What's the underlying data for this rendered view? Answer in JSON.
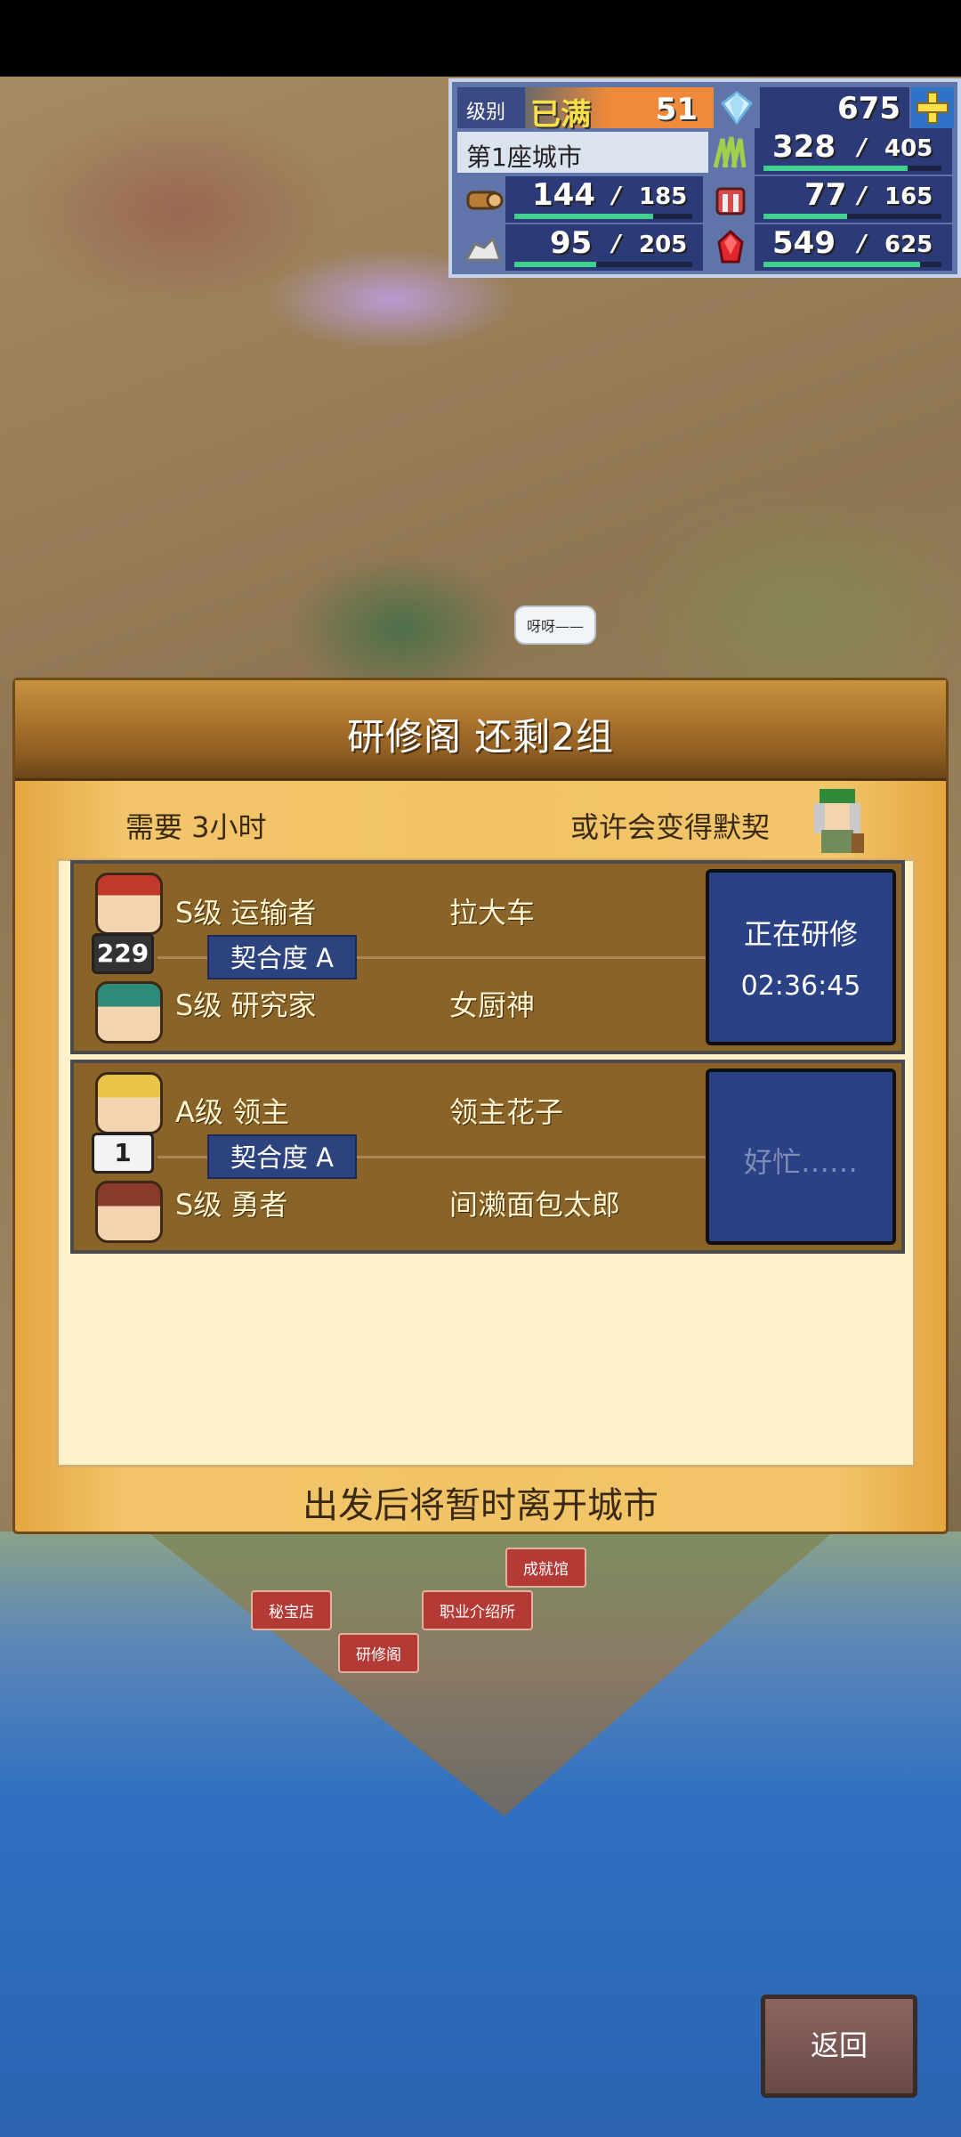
{
  "hud": {
    "level_label": "级别",
    "level_status": "已满",
    "level_value": "51",
    "gems": "675",
    "plus_icon": "plus-icon",
    "city_name": "第1座城市",
    "resources": [
      {
        "icon": "grass-icon",
        "current": "328",
        "max": "405",
        "fill": 0.81
      },
      {
        "icon": "wood-icon",
        "current": "144",
        "max": "185",
        "fill": 0.78
      },
      {
        "icon": "tools-icon",
        "current": "77",
        "max": "165",
        "fill": 0.47
      },
      {
        "icon": "ore-icon",
        "current": "95",
        "max": "205",
        "fill": 0.46
      },
      {
        "icon": "ruby-icon",
        "current": "549",
        "max": "625",
        "fill": 0.88
      }
    ],
    "colors": {
      "accent_orange": "#f08a3a",
      "bar_green": "#3fd18d",
      "panel_blue": "#2c3a77"
    }
  },
  "map": {
    "speech_bubble": "呀呀——",
    "labels": {
      "achievement_hall": "成就馆",
      "treasure_shop": "秘宝店",
      "job_agency": "职业介绍所",
      "training_pavilion": "研修阁"
    }
  },
  "panel": {
    "title": "研修阁 还剩2组",
    "requirement": "需要 3小时",
    "hint": "或许会变得默契",
    "footer": "出发后将暂时离开城市",
    "pairs": [
      {
        "top": {
          "rank_job": "S级 运输者",
          "name": "拉大车"
        },
        "bottom": {
          "rank_job": "S级 研究家",
          "name": "女厨神"
        },
        "affinity": "契合度 A",
        "avatar_badge": "229",
        "status_label": "正在研修",
        "status_timer": "02:36:45"
      },
      {
        "top": {
          "rank_job": "A级 领主",
          "name": "领主花子"
        },
        "bottom": {
          "rank_job": "S级 勇者",
          "name": "间濑面包太郎"
        },
        "affinity": "契合度 A",
        "avatar_badge": "1",
        "status_label": "好忙……",
        "status_timer": ""
      }
    ]
  },
  "back_button": "返回"
}
